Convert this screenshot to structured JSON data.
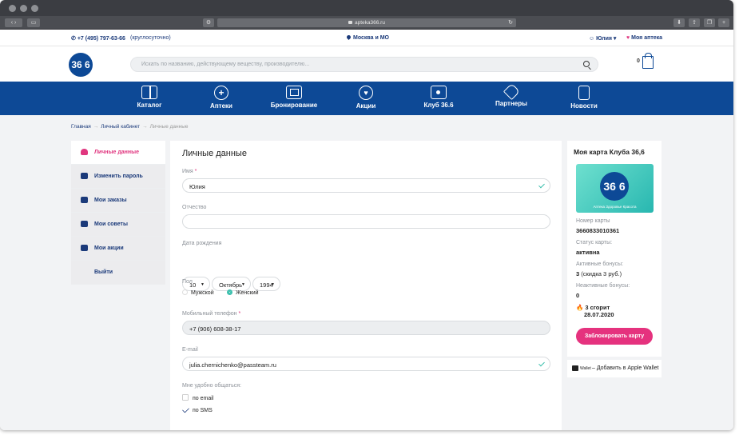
{
  "browser": {
    "url": "apteka366.ru"
  },
  "topline": {
    "phone": "+7 (495) 797-63-66",
    "hours": "(круглосуточно)",
    "region": "Москва и МО",
    "user": "Юлия",
    "my_pharmacy": "Моя аптека"
  },
  "header": {
    "logo_text": "36 6",
    "search_placeholder": "Искать по названию, действующему веществу, производителю...",
    "cart_count": "0"
  },
  "nav": {
    "items": [
      {
        "label": "Каталог",
        "icon": "book-icon"
      },
      {
        "label": "Аптеки",
        "icon": "pharmacy-cross-icon"
      },
      {
        "label": "Бронирование",
        "icon": "monitor-icon"
      },
      {
        "label": "Акции",
        "icon": "heart-icon"
      },
      {
        "label": "Клуб 36.6",
        "icon": "club-card-icon"
      },
      {
        "label": "Партнеры",
        "icon": "handshake-icon"
      },
      {
        "label": "Новости",
        "icon": "document-icon"
      }
    ]
  },
  "breadcrumb": {
    "items": [
      "Главная",
      "Личный кабинет",
      "Личные данные"
    ]
  },
  "sidebar": {
    "items": [
      {
        "label": "Личные данные",
        "icon": "person-icon",
        "active": true
      },
      {
        "label": "Изменить пароль",
        "icon": "wrench-icon"
      },
      {
        "label": "Мои заказы",
        "icon": "basket-icon"
      },
      {
        "label": "Мои советы",
        "icon": "chat-icon"
      },
      {
        "label": "Мои акции",
        "icon": "tag-icon"
      },
      {
        "label": "Выйти"
      }
    ]
  },
  "form": {
    "title": "Личные данные",
    "name_label": "Имя",
    "name_value": "Юлия",
    "patronymic_label": "Отчество",
    "patronymic_value": "",
    "birth_label": "Дата рождения",
    "birth_day": "10",
    "birth_month": "Октябрь",
    "birth_year": "1994",
    "gender_label": "Пол",
    "gender_male": "Мужской",
    "gender_female": "Женский",
    "gender_selected": "Женский",
    "phone_label": "Мобильный телефон",
    "phone_value": "+7 (906) 608-38-17",
    "email_label": "E-mail",
    "email_value": "julia.chernichenko@passteam.ru",
    "contact_label": "Мне удобно общаться:",
    "contact_email": "по email",
    "contact_sms": "по SMS",
    "contact_email_checked": false,
    "contact_sms_checked": true,
    "required_mark": "*"
  },
  "club_card": {
    "title": "Моя карта Клуба 36,6",
    "card_logo": "36 6",
    "card_tags": "Аптека   Здоровье   Красота",
    "number_label": "Номер карты",
    "number_value": "3660833010361",
    "status_label": "Статус карты:",
    "status_value": "активна",
    "active_label": "Активные бонусы:",
    "active_value": "3",
    "active_sub": "(скидка 3 руб.)",
    "inactive_label": "Неактивные бонусы:",
    "inactive_value": "0",
    "burn_text": "3 сгорит",
    "burn_date": "28.07.2020",
    "block_button": "Заблокировать карту"
  },
  "wallet": {
    "logo": "Wallet",
    "label": "– Добавить в Apple Wallet"
  },
  "colors": {
    "brand_blue": "#0d4996",
    "accent_pink": "#e5327e",
    "teal": "#3bbfad"
  }
}
